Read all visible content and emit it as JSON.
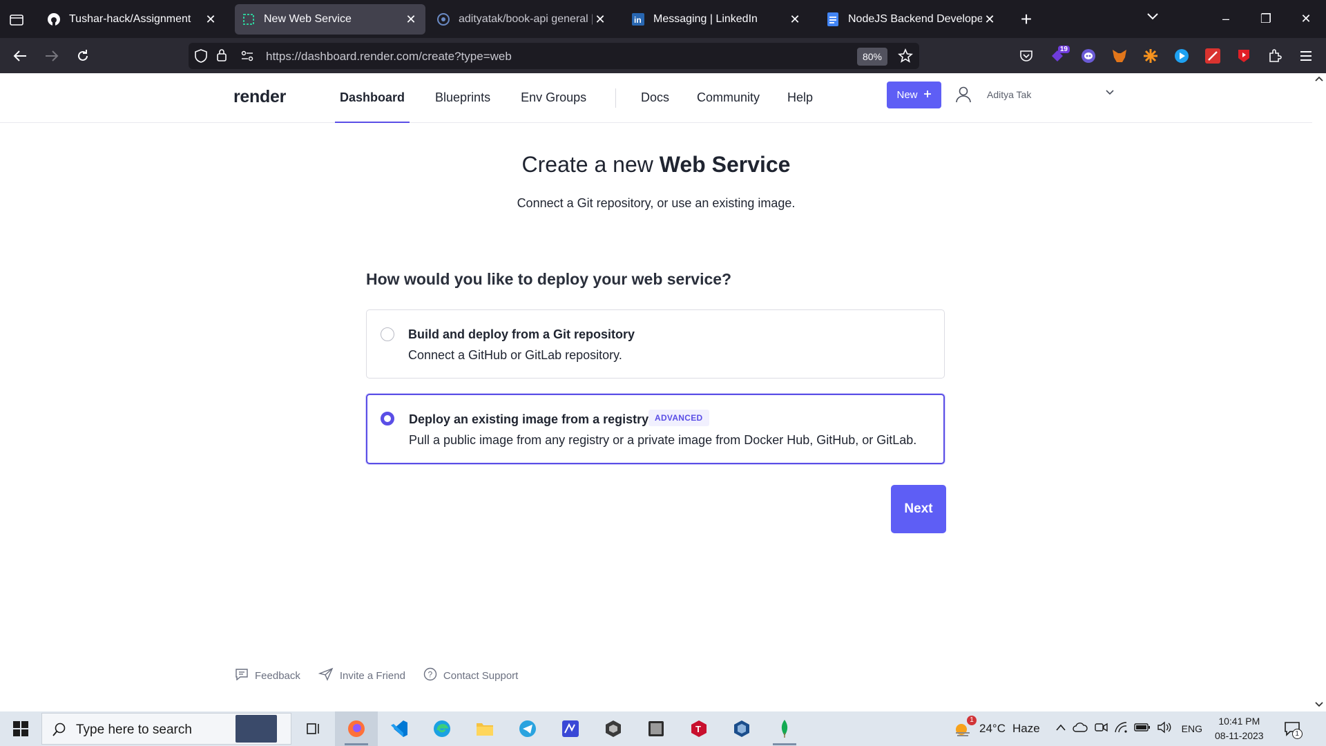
{
  "browser": {
    "tabs": [
      {
        "title": "Tushar-hack/Assignment",
        "favicon": "github-icon",
        "active": false
      },
      {
        "title": "New Web Service",
        "favicon": "render-icon",
        "active": true
      },
      {
        "title": "adityatak/book-api general | D",
        "favicon": "cloud-icon",
        "active": false
      },
      {
        "title": "Messaging | LinkedIn",
        "favicon": "linkedin-icon",
        "active": false
      },
      {
        "title": "NodeJS Backend Developer Ch",
        "favicon": "doc-icon",
        "active": false
      }
    ],
    "url": "https://dashboard.render.com/create?type=web",
    "zoom": "80%",
    "extension_badge": "19"
  },
  "app": {
    "logo": "render",
    "nav": {
      "dashboard": "Dashboard",
      "blueprints": "Blueprints",
      "env_groups": "Env Groups",
      "docs": "Docs",
      "community": "Community",
      "help": "Help"
    },
    "new_button": "New",
    "user_name": "Aditya Tak",
    "accent_color": "#5e5ef5"
  },
  "main": {
    "title_prefix": "Create a new",
    "title_bold": "Web Service",
    "subtitle": "Connect a Git repository, or use an existing image.",
    "question": "How would you like to deploy your web service?",
    "options": [
      {
        "title": "Build and deploy from a Git repository",
        "desc": "Connect a GitHub or GitLab repository.",
        "tag": "",
        "selected": false
      },
      {
        "title": "Deploy an existing image from a registry",
        "desc": "Pull a public image from any registry or a private image from Docker Hub, GitHub, or GitLab.",
        "tag": "ADVANCED",
        "selected": true
      }
    ],
    "next_button": "Next"
  },
  "footer": {
    "feedback": "Feedback",
    "invite": "Invite a Friend",
    "support": "Contact Support"
  },
  "taskbar": {
    "search_placeholder": "Type here to search",
    "weather_temp": "24°C",
    "weather_desc": "Haze",
    "weather_badge": "1",
    "language": "ENG",
    "time": "10:41 PM",
    "date": "08-11-2023",
    "notification_count": "1"
  }
}
